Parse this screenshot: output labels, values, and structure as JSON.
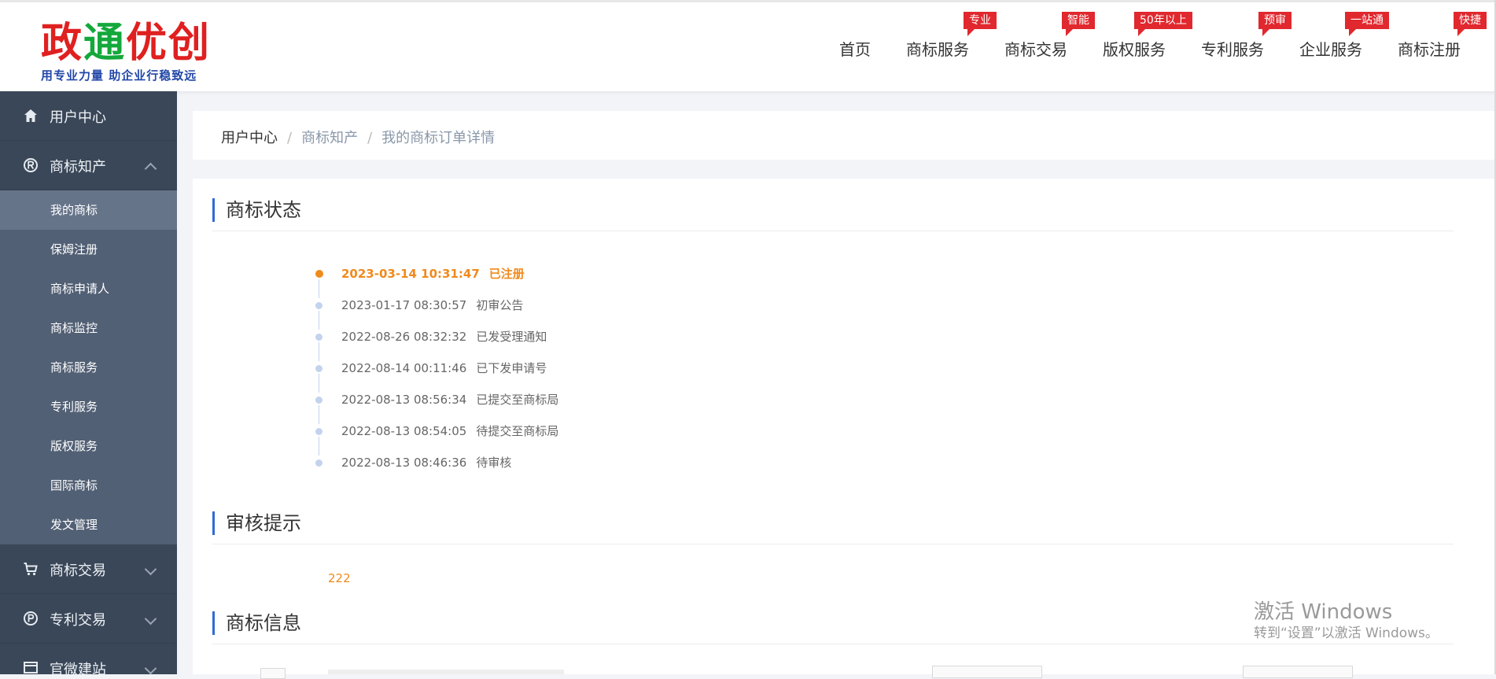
{
  "header": {
    "logo": {
      "title_parts": [
        "政",
        "通",
        "优",
        "创"
      ],
      "slogan": "用专业力量  助企业行稳致远"
    },
    "nav": [
      {
        "label": "首页",
        "badge": ""
      },
      {
        "label": "商标服务",
        "badge": "专业"
      },
      {
        "label": "商标交易",
        "badge": "智能"
      },
      {
        "label": "版权服务",
        "badge": "50年以上"
      },
      {
        "label": "专利服务",
        "badge": "预审"
      },
      {
        "label": "企业服务",
        "badge": "一站通"
      },
      {
        "label": "商标注册",
        "badge": "快捷"
      }
    ]
  },
  "sidebar": {
    "groups": [
      {
        "label": "用户中心",
        "icon": "home-icon",
        "expanded": false
      },
      {
        "label": "商标知产",
        "icon": "registered-icon",
        "expanded": true,
        "items": [
          {
            "label": "我的商标",
            "active": true
          },
          {
            "label": "保姆注册"
          },
          {
            "label": "商标申请人"
          },
          {
            "label": "商标监控"
          },
          {
            "label": "商标服务"
          },
          {
            "label": "专利服务"
          },
          {
            "label": "版权服务"
          },
          {
            "label": "国际商标"
          },
          {
            "label": "发文管理"
          }
        ]
      },
      {
        "label": "商标交易",
        "icon": "cart-icon",
        "expanded": false
      },
      {
        "label": "专利交易",
        "icon": "patent-icon",
        "expanded": false
      },
      {
        "label": "官微建站",
        "icon": "site-icon",
        "expanded": false
      }
    ]
  },
  "breadcrumb": {
    "items": [
      "用户中心",
      "商标知产",
      "我的商标订单详情"
    ],
    "separator": "/"
  },
  "sections": {
    "status_title": "商标状态",
    "review_title": "审核提示",
    "info_title": "商标信息"
  },
  "timeline": [
    {
      "time": "2023-03-14 10:31:47",
      "status": "已注册",
      "current": true
    },
    {
      "time": "2023-01-17 08:30:57",
      "status": "初审公告"
    },
    {
      "time": "2022-08-26 08:32:32",
      "status": "已发受理通知"
    },
    {
      "time": "2022-08-14 00:11:46",
      "status": "已下发申请号"
    },
    {
      "time": "2022-08-13 08:56:34",
      "status": "已提交至商标局"
    },
    {
      "time": "2022-08-13 08:54:05",
      "status": "待提交至商标局"
    },
    {
      "time": "2022-08-13 08:46:36",
      "status": "待审核"
    }
  ],
  "review_hint": "222",
  "watermark": {
    "line1": "激活 Windows",
    "line2": "转到“设置”以激活 Windows。"
  },
  "colors": {
    "accent": "#2f6bd7",
    "highlight": "#f08a1c",
    "badge": "#e0282e",
    "sidebar": "#3a4758",
    "sidebar_sub": "#526075"
  }
}
